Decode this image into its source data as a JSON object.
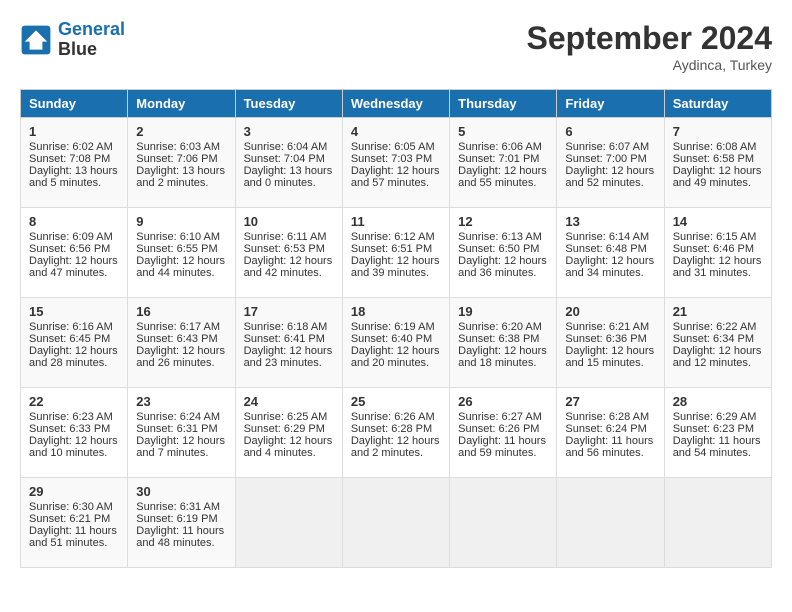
{
  "header": {
    "logo_line1": "General",
    "logo_line2": "Blue",
    "month_title": "September 2024",
    "location": "Aydinca, Turkey"
  },
  "days_of_week": [
    "Sunday",
    "Monday",
    "Tuesday",
    "Wednesday",
    "Thursday",
    "Friday",
    "Saturday"
  ],
  "weeks": [
    [
      {
        "day": "1",
        "info": "Sunrise: 6:02 AM\nSunset: 7:08 PM\nDaylight: 13 hours and 5 minutes."
      },
      {
        "day": "2",
        "info": "Sunrise: 6:03 AM\nSunset: 7:06 PM\nDaylight: 13 hours and 2 minutes."
      },
      {
        "day": "3",
        "info": "Sunrise: 6:04 AM\nSunset: 7:04 PM\nDaylight: 13 hours and 0 minutes."
      },
      {
        "day": "4",
        "info": "Sunrise: 6:05 AM\nSunset: 7:03 PM\nDaylight: 12 hours and 57 minutes."
      },
      {
        "day": "5",
        "info": "Sunrise: 6:06 AM\nSunset: 7:01 PM\nDaylight: 12 hours and 55 minutes."
      },
      {
        "day": "6",
        "info": "Sunrise: 6:07 AM\nSunset: 7:00 PM\nDaylight: 12 hours and 52 minutes."
      },
      {
        "day": "7",
        "info": "Sunrise: 6:08 AM\nSunset: 6:58 PM\nDaylight: 12 hours and 49 minutes."
      }
    ],
    [
      {
        "day": "8",
        "info": "Sunrise: 6:09 AM\nSunset: 6:56 PM\nDaylight: 12 hours and 47 minutes."
      },
      {
        "day": "9",
        "info": "Sunrise: 6:10 AM\nSunset: 6:55 PM\nDaylight: 12 hours and 44 minutes."
      },
      {
        "day": "10",
        "info": "Sunrise: 6:11 AM\nSunset: 6:53 PM\nDaylight: 12 hours and 42 minutes."
      },
      {
        "day": "11",
        "info": "Sunrise: 6:12 AM\nSunset: 6:51 PM\nDaylight: 12 hours and 39 minutes."
      },
      {
        "day": "12",
        "info": "Sunrise: 6:13 AM\nSunset: 6:50 PM\nDaylight: 12 hours and 36 minutes."
      },
      {
        "day": "13",
        "info": "Sunrise: 6:14 AM\nSunset: 6:48 PM\nDaylight: 12 hours and 34 minutes."
      },
      {
        "day": "14",
        "info": "Sunrise: 6:15 AM\nSunset: 6:46 PM\nDaylight: 12 hours and 31 minutes."
      }
    ],
    [
      {
        "day": "15",
        "info": "Sunrise: 6:16 AM\nSunset: 6:45 PM\nDaylight: 12 hours and 28 minutes."
      },
      {
        "day": "16",
        "info": "Sunrise: 6:17 AM\nSunset: 6:43 PM\nDaylight: 12 hours and 26 minutes."
      },
      {
        "day": "17",
        "info": "Sunrise: 6:18 AM\nSunset: 6:41 PM\nDaylight: 12 hours and 23 minutes."
      },
      {
        "day": "18",
        "info": "Sunrise: 6:19 AM\nSunset: 6:40 PM\nDaylight: 12 hours and 20 minutes."
      },
      {
        "day": "19",
        "info": "Sunrise: 6:20 AM\nSunset: 6:38 PM\nDaylight: 12 hours and 18 minutes."
      },
      {
        "day": "20",
        "info": "Sunrise: 6:21 AM\nSunset: 6:36 PM\nDaylight: 12 hours and 15 minutes."
      },
      {
        "day": "21",
        "info": "Sunrise: 6:22 AM\nSunset: 6:34 PM\nDaylight: 12 hours and 12 minutes."
      }
    ],
    [
      {
        "day": "22",
        "info": "Sunrise: 6:23 AM\nSunset: 6:33 PM\nDaylight: 12 hours and 10 minutes."
      },
      {
        "day": "23",
        "info": "Sunrise: 6:24 AM\nSunset: 6:31 PM\nDaylight: 12 hours and 7 minutes."
      },
      {
        "day": "24",
        "info": "Sunrise: 6:25 AM\nSunset: 6:29 PM\nDaylight: 12 hours and 4 minutes."
      },
      {
        "day": "25",
        "info": "Sunrise: 6:26 AM\nSunset: 6:28 PM\nDaylight: 12 hours and 2 minutes."
      },
      {
        "day": "26",
        "info": "Sunrise: 6:27 AM\nSunset: 6:26 PM\nDaylight: 11 hours and 59 minutes."
      },
      {
        "day": "27",
        "info": "Sunrise: 6:28 AM\nSunset: 6:24 PM\nDaylight: 11 hours and 56 minutes."
      },
      {
        "day": "28",
        "info": "Sunrise: 6:29 AM\nSunset: 6:23 PM\nDaylight: 11 hours and 54 minutes."
      }
    ],
    [
      {
        "day": "29",
        "info": "Sunrise: 6:30 AM\nSunset: 6:21 PM\nDaylight: 11 hours and 51 minutes."
      },
      {
        "day": "30",
        "info": "Sunrise: 6:31 AM\nSunset: 6:19 PM\nDaylight: 11 hours and 48 minutes."
      },
      {
        "day": "",
        "info": ""
      },
      {
        "day": "",
        "info": ""
      },
      {
        "day": "",
        "info": ""
      },
      {
        "day": "",
        "info": ""
      },
      {
        "day": "",
        "info": ""
      }
    ]
  ]
}
